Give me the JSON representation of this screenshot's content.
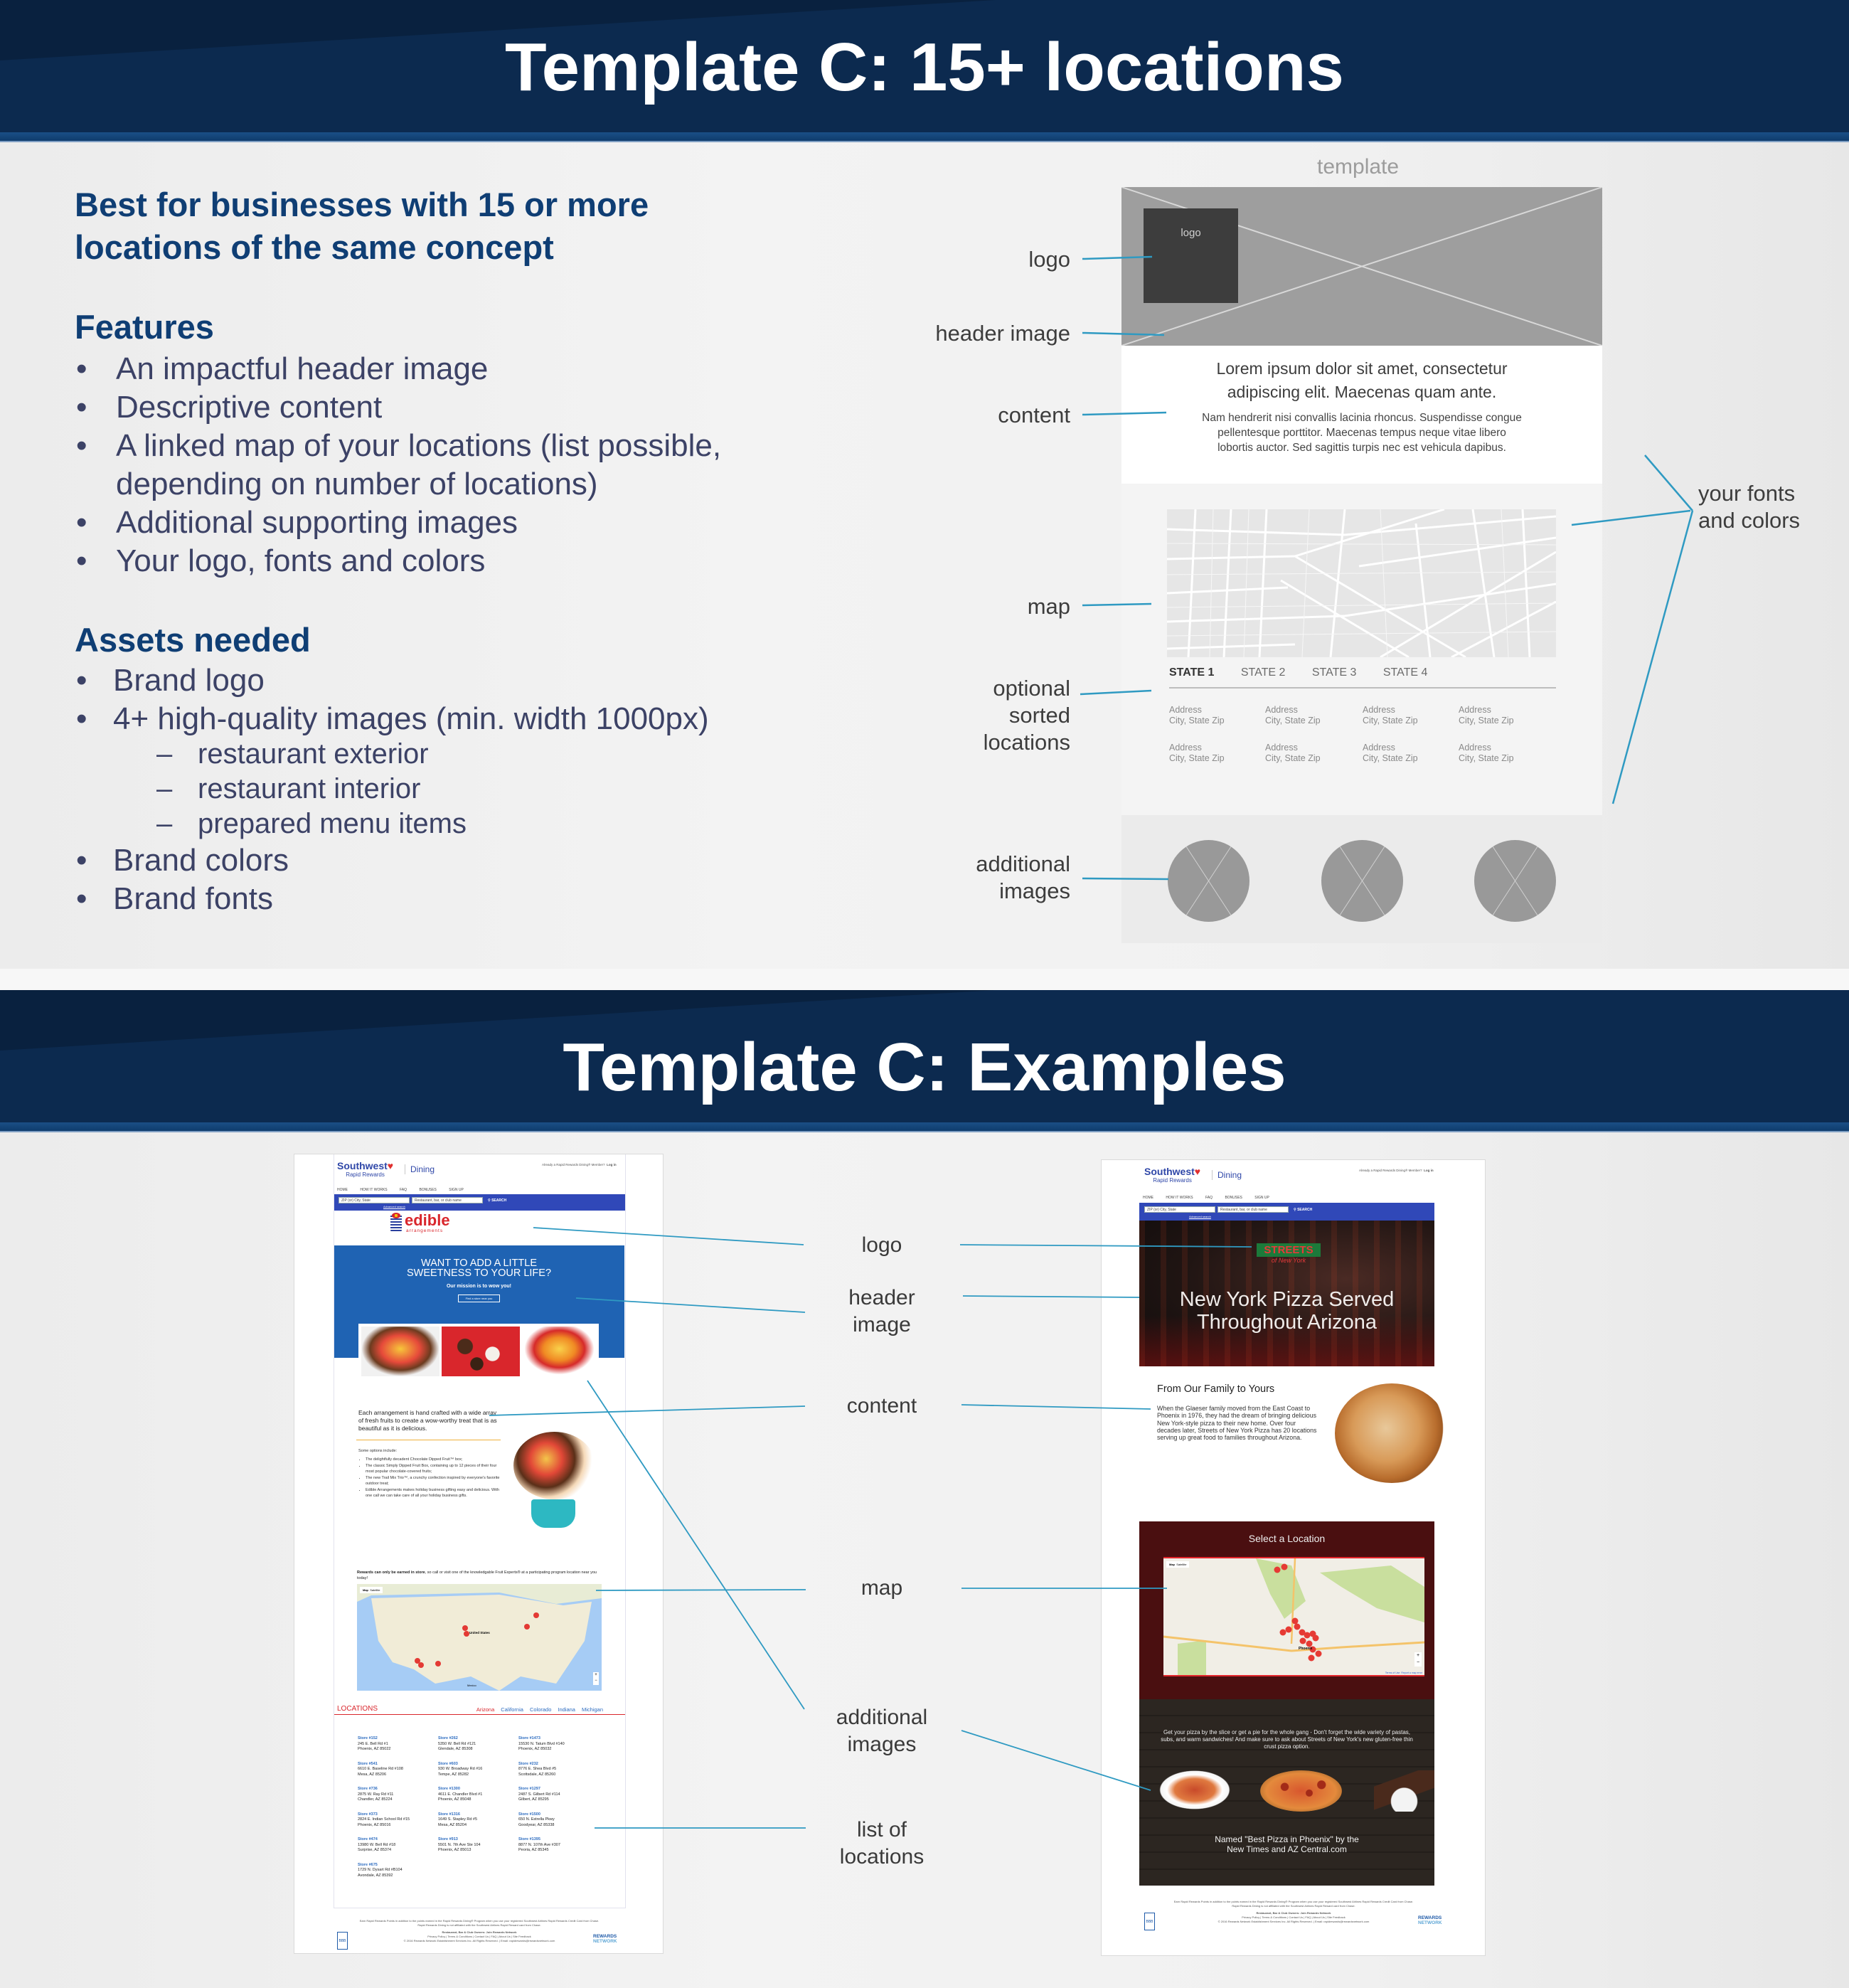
{
  "slide1": {
    "title": "Template C: 15+ locations",
    "lead": [
      "Best for businesses with 15 or more",
      "locations of the same concept"
    ],
    "features_heading": "Features",
    "features": [
      "An impactful header image",
      "Descriptive content",
      "A linked map of your locations (list possible,",
      "depending on number of locations)",
      "Additional supporting images",
      "Your logo, fonts and colors"
    ],
    "assets_heading": "Assets needed",
    "assets": [
      "Brand logo",
      "4+ high-quality images (min. width 1000px)"
    ],
    "assets_sub": [
      "restaurant exterior",
      "restaurant interior",
      "prepared menu items"
    ],
    "assets_more": [
      "Brand colors",
      "Brand fonts"
    ],
    "wireframe": {
      "title": "template",
      "logo_box": "logo",
      "content_big": [
        "Lorem ipsum dolor sit amet, consectetur",
        "adipiscing elit. Maecenas quam ante."
      ],
      "content_small": [
        "Nam hendrerit nisi convallis lacinia rhoncus. Suspendisse congue",
        "pellentesque porttitor. Maecenas tempus neque vitae libero",
        "lobortis auctor. Sed sagittis turpis nec est vehicula dapibus."
      ],
      "tabs": [
        "STATE 1",
        "STATE 2",
        "STATE 3",
        "STATE 4"
      ],
      "address_line1": "Address",
      "address_line2": "City, State Zip",
      "labels": {
        "logo": "logo",
        "header_image": "header image",
        "content": "content",
        "map": "map",
        "sorted": [
          "optional",
          "sorted",
          "locations"
        ],
        "additional": [
          "additional",
          "images"
        ],
        "fonts": [
          "your fonts",
          "and colors"
        ]
      }
    }
  },
  "slide2": {
    "title": "Template C: Examples",
    "labels": {
      "logo": "logo",
      "header_image": [
        "header",
        "image"
      ],
      "content": "content",
      "map": "map",
      "additional": [
        "additional",
        "images"
      ],
      "list": [
        "list of",
        "locations"
      ]
    },
    "southwest": {
      "brand": "Southwest",
      "sub": "Rapid Rewards",
      "dining": "Dining",
      "member_text": "Already a Rapid Rewards Dining® Member?",
      "login": "Log in",
      "nav": [
        "HOME",
        "HOW IT WORKS",
        "FAQ",
        "BONUSES",
        "SIGN UP"
      ],
      "zip_placeholder": "ZIP (or) City, State",
      "name_placeholder": "Restaurant, bar, or club name",
      "search": "SEARCH",
      "advanced": "Advanced search",
      "footer_line1": "Earn Rapid Rewards Points in addition to the points earned in the Rapid Rewards Dining® Program when you use your registered Southwest Airlines Rapid Rewards Credit Card from Chase.",
      "footer_line2": "Rapid Rewards Dining is not affiliated with the Southwest Airlines Rapid Reward card from Chase.",
      "footer_owners": "Restaurant, Bar & Club Owners: Join Rewards Network",
      "footer_links": "Privacy Policy | Terms & Conditions | Contact Us | FAQ | About Us | Site Feedback",
      "footer_copy": "© 2016 Rewards Network Establishment Services Inc. All Rights Reserved. | Email: rapidrewards@rewardsnetwork.com",
      "rewards_network": [
        "REWARDS",
        "NETWORK"
      ],
      "bbb": "BBB"
    },
    "edible": {
      "logo_main": "edible",
      "logo_sub": "arrangements",
      "hero_title": [
        "WANT TO ADD A LITTLE",
        "SWEETNESS TO YOUR LIFE?"
      ],
      "hero_sub": "Our mission is to wow you!",
      "hero_btn": "Find a store near you",
      "intro": "Each arrangement is hand crafted with a wide array of fresh fruits to create a wow-worthy treat that is as beautiful as it is delicious.",
      "options_heading": "Some options include:",
      "options": [
        "The delightfully decadent Chocolate Dipped Fruit™ box;",
        "The classic Simply Dipped Fruit Box, containing up to 12 pieces of their four most popular chocolate-covered fruits;",
        "The new Trail Mix Trio™, a crunchy confection inspired by everyone's favorite outdoor treat;",
        "Edible Arrangements makes holiday business gifting easy and delicious. With one call we can take care of all your holiday business gifts."
      ],
      "rewards_bold": "Rewards can only be earned in store",
      "rewards_rest": ", so call or visit one of the knowledgable Fruit Experts® at a participating program location near you today!",
      "map_tabs": [
        "Map",
        "Satellite"
      ],
      "map_labels": [
        "United States",
        "Mexico"
      ],
      "locations_heading": "LOCATIONS",
      "states": [
        "Arizona",
        "California",
        "Colorado",
        "Indiana",
        "Michigan"
      ],
      "active_state": "Arizona",
      "stores": [
        {
          "name": "Store #152",
          "addr": "245 E. Bell Rd #1",
          "city": "Phoenix, AZ 85022"
        },
        {
          "name": "Store #262",
          "addr": "5350 W. Bell Rd #121",
          "city": "Glendale, AZ 85308"
        },
        {
          "name": "Store #1473",
          "addr": "15530 N. Tatum Blvd #140",
          "city": "Phoenix, AZ 85032"
        },
        {
          "name": "Store #541",
          "addr": "6610 E. Baseline Rd #108",
          "city": "Mesa, AZ 85206"
        },
        {
          "name": "Store #603",
          "addr": "930 W. Broadway Rd #16",
          "city": "Tempe, AZ 85282"
        },
        {
          "name": "Store #232",
          "addr": "8776 E. Shea Blvd #5",
          "city": "Scottsdale, AZ 85260"
        },
        {
          "name": "Store #736",
          "addr": "2875 W. Ray Rd #11",
          "city": "Chandler, AZ 85224"
        },
        {
          "name": "Store #1300",
          "addr": "4611 E. Chandler Blvd #1",
          "city": "Phoenix, AZ 85048"
        },
        {
          "name": "Store #1297",
          "addr": "2487 S. Gilbert Rd #114",
          "city": "Gilbert, AZ 85295"
        },
        {
          "name": "Store #373",
          "addr": "2824 E. Indian School Rd #15",
          "city": "Phoenix, AZ 85016"
        },
        {
          "name": "Store #1316",
          "addr": "1649 S. Stapley Rd #5",
          "city": "Mesa, AZ 85204"
        },
        {
          "name": "Store #1500",
          "addr": "650 N. Estrella Pkwy",
          "city": "Goodyear, AZ 85338"
        },
        {
          "name": "Store #474",
          "addr": "13980 W. Bell Rd #18",
          "city": "Surprise, AZ 85374"
        },
        {
          "name": "Store #913",
          "addr": "5501 N. 7th Ave Ste 104",
          "city": "Phoenix, AZ 85013"
        },
        {
          "name": "Store #1395",
          "addr": "8877 N. 107th Ave #307",
          "city": "Peoria, AZ 85345"
        },
        {
          "name": "Store #675",
          "addr": "1729 N. Dysart Rd #B104",
          "city": "Avondale, AZ 85392"
        }
      ]
    },
    "streets": {
      "logo": [
        "STREETS",
        "of New York"
      ],
      "hero": [
        "New York Pizza Served",
        "Throughout Arizona"
      ],
      "content_heading": "From Our Family to Yours",
      "content_body": "When the Glaeser family moved from the East Coast to Phoenix in 1976, they had the dream of bringing delicious New York-style pizza to their new home. Over four decades later, Streets of New York Pizza has 20 locations serving up great food to families throughout Arizona.",
      "map_heading": "Select a Location",
      "map_tabs": [
        "Map",
        "Satellite"
      ],
      "map_city": "Phoenix",
      "map_footer": [
        "Terms of Use",
        "Report a map error"
      ],
      "promo": "Get your pizza by the slice or get a pie for the whole gang - Don't forget the wide variety of pastas, subs, and warm sandwiches! And make sure to ask about Streets of New York's new gluten-free thin crust pizza option.",
      "award": [
        "Named \"Best Pizza in Phoenix\" by the",
        "New Times and AZ Central.com"
      ]
    }
  },
  "colors": {
    "banner": "#0c2a4f",
    "heading_blue": "#0f3e74",
    "bullet_text": "#3c4266",
    "callout": "#2f9ac2",
    "southwest_blue": "#3048b8",
    "edible_blue": "#1f63b3",
    "edible_red": "#d9262c",
    "streets_maroon": "#4a0f10"
  }
}
